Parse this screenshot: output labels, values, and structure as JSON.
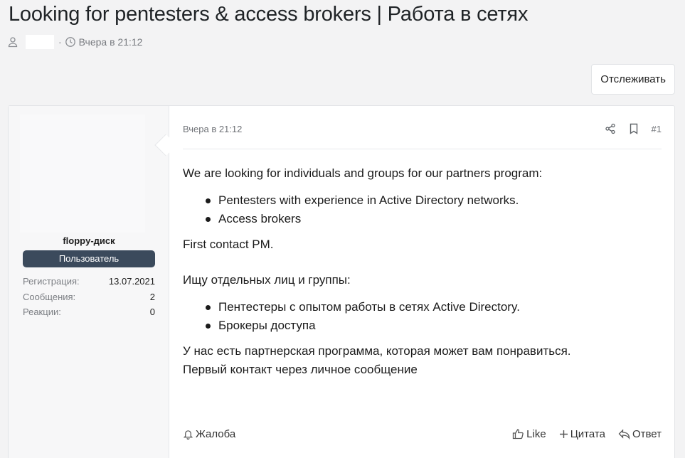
{
  "thread": {
    "title": "Looking for pentesters & access brokers | Работа в сетях",
    "date": "Вчера в 21:12"
  },
  "actions": {
    "follow_label": "Отслеживать"
  },
  "post": {
    "date": "Вчера в 21:12",
    "number": "#1",
    "paragraphs": {
      "p1": "We are looking for individuals and groups for our partners program:",
      "p2": "First contact PM.",
      "p3": "Ищу отдельных лиц и группы:",
      "p4_line1": "У нас есть партнерская программа, которая может вам понравиться.",
      "p4_line2": "Первый контакт через личное сообщение"
    },
    "list_en": [
      "Pentesters with experience in Active Directory networks.",
      "Access brokers"
    ],
    "list_ru": [
      "Пентестеры с опытом работы в сетях Active Directory.",
      "Брокеры доступа"
    ],
    "footer": {
      "report": "Жалоба",
      "like": "Like",
      "quote": "Цитата",
      "reply": "Ответ"
    }
  },
  "user": {
    "name": "floppy-диск",
    "role": "Пользователь",
    "stats": [
      {
        "label": "Регистрация:",
        "value": "13.07.2021"
      },
      {
        "label": "Сообщения:",
        "value": "2"
      },
      {
        "label": "Реакции:",
        "value": "0"
      }
    ]
  },
  "icons": [
    "user-icon",
    "clock-icon",
    "share-icon",
    "bookmark-icon",
    "bell-icon",
    "thumbs-up-icon",
    "plus-icon",
    "reply-icon"
  ]
}
